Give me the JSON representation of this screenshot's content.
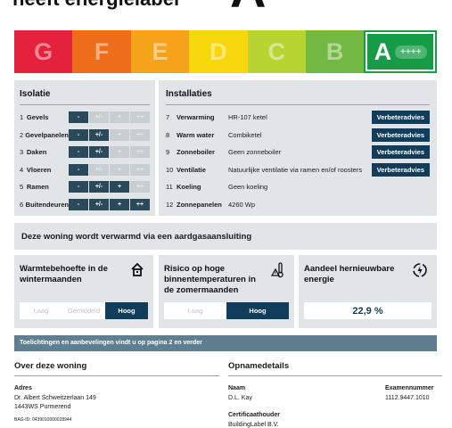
{
  "header": {
    "title": "heeft energielabel",
    "label_letter": "A"
  },
  "energy_band": {
    "segments": [
      {
        "letter": "G",
        "color": "#e4223b"
      },
      {
        "letter": "F",
        "color": "#ee6d1b"
      },
      {
        "letter": "E",
        "color": "#f5a31a"
      },
      {
        "letter": "D",
        "color": "#f8d80d"
      },
      {
        "letter": "C",
        "color": "#b8d433"
      },
      {
        "letter": "B",
        "color": "#72b843"
      },
      {
        "letter": "A",
        "color": "#169b46",
        "active": true,
        "suffix": "++++"
      }
    ]
  },
  "isolatie": {
    "title": "Isolatie",
    "rows": [
      {
        "num": "1",
        "label": "Gevels",
        "cells": [
          "-",
          "+/-",
          "+",
          "++"
        ],
        "selected": 0
      },
      {
        "num": "2",
        "label": "Gevelpanelen",
        "cells": [
          "-",
          "+/-",
          "+",
          "++"
        ],
        "selected": 1
      },
      {
        "num": "3",
        "label": "Daken",
        "cells": [
          "-",
          "+/-",
          "+",
          "++"
        ],
        "selected": 1
      },
      {
        "num": "4",
        "label": "Vloeren",
        "cells": [
          "-",
          "+/-",
          "+",
          "++"
        ],
        "selected": 0
      },
      {
        "num": "5",
        "label": "Ramen",
        "cells": [
          "-",
          "+/-",
          "+",
          "++"
        ],
        "selected": 2
      },
      {
        "num": "6",
        "label": "Buitendeuren",
        "cells": [
          "-",
          "+/-",
          "+",
          "++"
        ],
        "selected": 3
      }
    ]
  },
  "installaties": {
    "title": "Installaties",
    "rows": [
      {
        "num": "7",
        "label": "Verwarming",
        "value": "HR-107 ketel",
        "button": "Verbeteradvies"
      },
      {
        "num": "8",
        "label": "Warm water",
        "value": "Combiketel",
        "button": "Verbeteradvies"
      },
      {
        "num": "9",
        "label": "Zonneboiler",
        "value": "Geen zonneboiler",
        "button": "Verbeteradvies"
      },
      {
        "num": "10",
        "label": "Ventilatie",
        "value": "Natuurlijke ventilatie via ramen en/of roosters",
        "button": "Verbeteradvies"
      },
      {
        "num": "11",
        "label": "Koeling",
        "value": "Geen koeling",
        "button": ""
      },
      {
        "num": "12",
        "label": "Zonnepanelen",
        "value": "4260 Wp",
        "button": ""
      }
    ]
  },
  "heating": {
    "text": "Deze woning wordt verwarmd via een aardgasaansluiting"
  },
  "warmtebehoefte": {
    "title": "Warmtebehoefte in de wintermaanden",
    "options": [
      "Laag",
      "Gemiddeld",
      "Hoog"
    ],
    "selected": 2
  },
  "risico": {
    "title": "Risico op hoge binnentemperaturen in de zomermaanden",
    "options": [
      "Laag",
      "Hoog"
    ],
    "selected": 1
  },
  "hernieuwbaar": {
    "title": "Aandeel hernieuwbare energie",
    "value": "22,9 %"
  },
  "note": "Toelichtingen en aanbevelingen vindt u op pagina 2 en verder",
  "about": {
    "heading": "Over deze woning",
    "adres_label": "Adres",
    "adres_line1": "Dr. Albert Schweitzerlaan 149",
    "adres_line2": "1443WS Purmerend",
    "bag_id": "BAG-ID: 0439010000028944"
  },
  "opname": {
    "heading": "Opnamedetails",
    "naam_label": "Naam",
    "naam_value": "D.L. Kay",
    "exam_label": "Examennummer",
    "exam_value": "1112.9447.1010",
    "cert_label": "Certificaathouder",
    "cert_value": "BuildingLabel B.V."
  }
}
